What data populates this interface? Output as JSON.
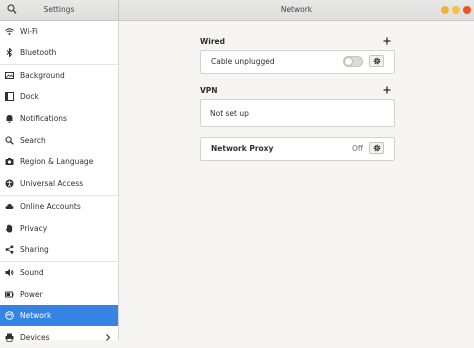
{
  "window": {
    "left_title": "Settings",
    "right_title": "Network"
  },
  "sidebar": {
    "items": [
      {
        "label": "Wi-Fi",
        "icon": "wifi-icon"
      },
      {
        "label": "Bluetooth",
        "icon": "bluetooth-icon"
      },
      {
        "label": "Background",
        "icon": "background-icon"
      },
      {
        "label": "Dock",
        "icon": "dock-icon"
      },
      {
        "label": "Notifications",
        "icon": "bell-icon"
      },
      {
        "label": "Search",
        "icon": "search-icon"
      },
      {
        "label": "Region & Language",
        "icon": "camera-icon"
      },
      {
        "label": "Universal Access",
        "icon": "accessibility-icon"
      },
      {
        "label": "Online Accounts",
        "icon": "cloud-icon"
      },
      {
        "label": "Privacy",
        "icon": "hand-icon"
      },
      {
        "label": "Sharing",
        "icon": "share-icon"
      },
      {
        "label": "Sound",
        "icon": "speaker-icon"
      },
      {
        "label": "Power",
        "icon": "power-icon"
      },
      {
        "label": "Network",
        "icon": "network-icon",
        "active": true
      },
      {
        "label": "Devices",
        "icon": "printer-icon"
      }
    ]
  },
  "main": {
    "wired": {
      "title": "Wired",
      "connection_label": "Cable unplugged",
      "toggle_on": false
    },
    "vpn": {
      "title": "VPN",
      "empty_label": "Not set up"
    },
    "proxy": {
      "label": "Network Proxy",
      "status": "Off"
    }
  },
  "colors": {
    "accent": "#3584e4",
    "close_button": "#e95420",
    "window_buttons": "#f0b33a"
  }
}
